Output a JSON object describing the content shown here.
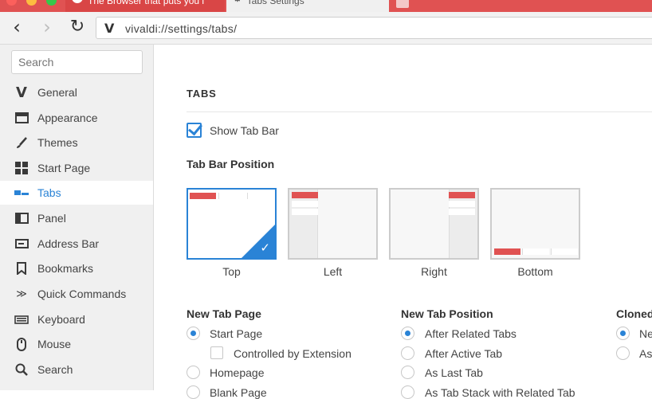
{
  "tabs": [
    {
      "title": "The Browser that puts you i",
      "icon": "vivaldi-logo-icon"
    },
    {
      "title": "Tabs Settings",
      "icon": "gear-icon"
    }
  ],
  "colors": {
    "tabstrip": "#e05252",
    "accent": "#2a83d6"
  },
  "address_bar": {
    "url": "vivaldi://settings/tabs/"
  },
  "sidebar": {
    "search_placeholder": "Search",
    "items": [
      {
        "label": "General",
        "icon": "vivaldi-icon"
      },
      {
        "label": "Appearance",
        "icon": "window-icon"
      },
      {
        "label": "Themes",
        "icon": "brush-icon"
      },
      {
        "label": "Start Page",
        "icon": "grid-icon"
      },
      {
        "label": "Tabs",
        "icon": "tabs-icon",
        "active": true
      },
      {
        "label": "Panel",
        "icon": "panel-icon"
      },
      {
        "label": "Address Bar",
        "icon": "address-bar-icon"
      },
      {
        "label": "Bookmarks",
        "icon": "bookmark-icon"
      },
      {
        "label": "Quick Commands",
        "icon": "quick-commands-icon"
      },
      {
        "label": "Keyboard",
        "icon": "keyboard-icon"
      },
      {
        "label": "Mouse",
        "icon": "mouse-icon"
      },
      {
        "label": "Search",
        "icon": "search-icon"
      }
    ]
  },
  "main": {
    "section_title": "TABS",
    "show_tab_bar": {
      "label": "Show Tab Bar",
      "checked": true
    },
    "tab_bar_position": {
      "heading": "Tab Bar Position",
      "options": [
        "Top",
        "Left",
        "Right",
        "Bottom"
      ],
      "selected": "Top"
    },
    "new_tab_page": {
      "heading": "New Tab Page",
      "options": [
        "Start Page",
        "Controlled by Extension",
        "Homepage",
        "Blank Page"
      ],
      "selected": "Start Page"
    },
    "new_tab_position": {
      "heading": "New Tab Position",
      "options": [
        "After Related Tabs",
        "After Active Tab",
        "As Last Tab",
        "As Tab Stack with Related Tab"
      ],
      "selected": "After Related Tabs"
    },
    "cloned": {
      "heading": "Cloned",
      "options": [
        "Ne",
        "As"
      ],
      "selected": "Ne"
    }
  }
}
